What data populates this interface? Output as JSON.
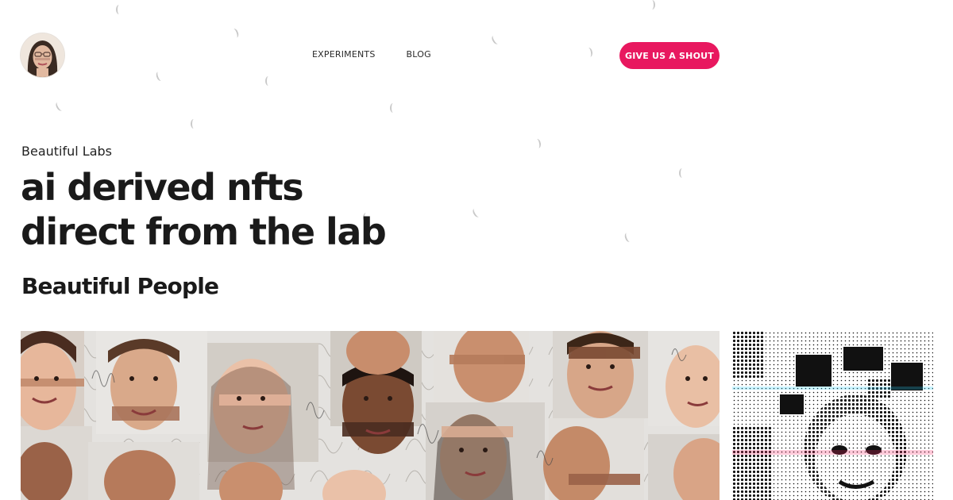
{
  "header": {
    "logo_icon": "face-portrait-icon",
    "nav": [
      {
        "label": "EXPERIMENTS"
      },
      {
        "label": "BLOG"
      }
    ],
    "cta_label": "GIVE US A SHOUT"
  },
  "hero": {
    "kicker": "Beautiful Labs",
    "headline_lines": [
      "ai derived nfts",
      "direct from the lab"
    ]
  },
  "section": {
    "title": "Beautiful People"
  },
  "gallery": {
    "main_image": "face-collage-image",
    "side_image": "halftone-face-image"
  },
  "colors": {
    "accent": "#e8185f",
    "text": "#1c1c1c",
    "background": "#ffffff"
  }
}
